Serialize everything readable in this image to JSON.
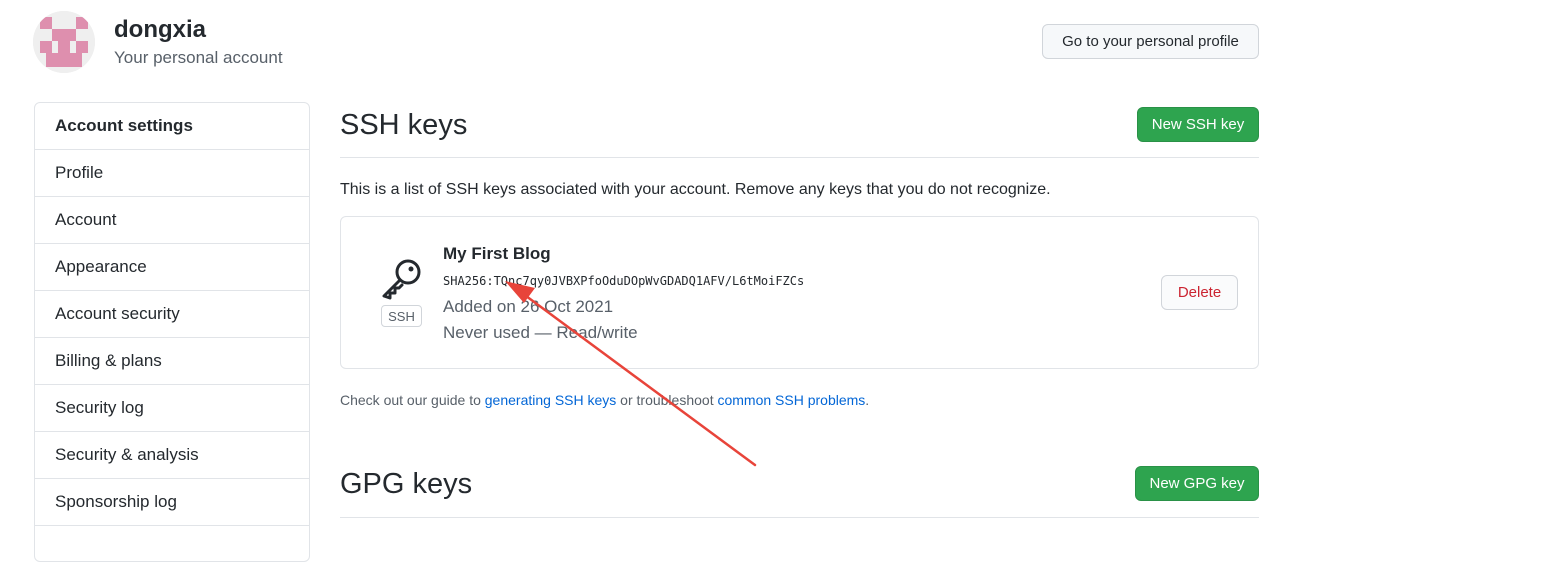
{
  "header": {
    "username": "dongxia",
    "subtitle": "Your personal account",
    "profile_button": "Go to your personal profile",
    "avatar_icon": "identicon-avatar"
  },
  "sidebar": {
    "items": [
      {
        "label": "Account settings"
      },
      {
        "label": "Profile"
      },
      {
        "label": "Account"
      },
      {
        "label": "Appearance"
      },
      {
        "label": "Account security"
      },
      {
        "label": "Billing & plans"
      },
      {
        "label": "Security log"
      },
      {
        "label": "Security & analysis"
      },
      {
        "label": "Sponsorship log"
      }
    ]
  },
  "ssh": {
    "title": "SSH keys",
    "new_button": "New SSH key",
    "description": "This is a list of SSH keys associated with your account. Remove any keys that you do not recognize.",
    "key": {
      "name": "My First Blog",
      "fingerprint": "SHA256:TQnc7qy0JVBXPfoOduDOpWvGDADQ1AFV/L6tMoiFZCs",
      "added": "Added on 26 Oct 2021",
      "usage": "Never used — Read/write",
      "badge": "SSH",
      "delete_button": "Delete",
      "icon": "key-icon"
    },
    "guide": {
      "prefix": "Check out our guide to ",
      "link1": "generating SSH keys",
      "middle": " or troubleshoot ",
      "link2": "common SSH problems",
      "suffix": "."
    }
  },
  "gpg": {
    "title": "GPG keys",
    "new_button": "New GPG key"
  },
  "colors": {
    "green": "#2ea44f",
    "danger": "#cb2431",
    "link": "#0366d6",
    "annotation_arrow": "#e8443a"
  }
}
